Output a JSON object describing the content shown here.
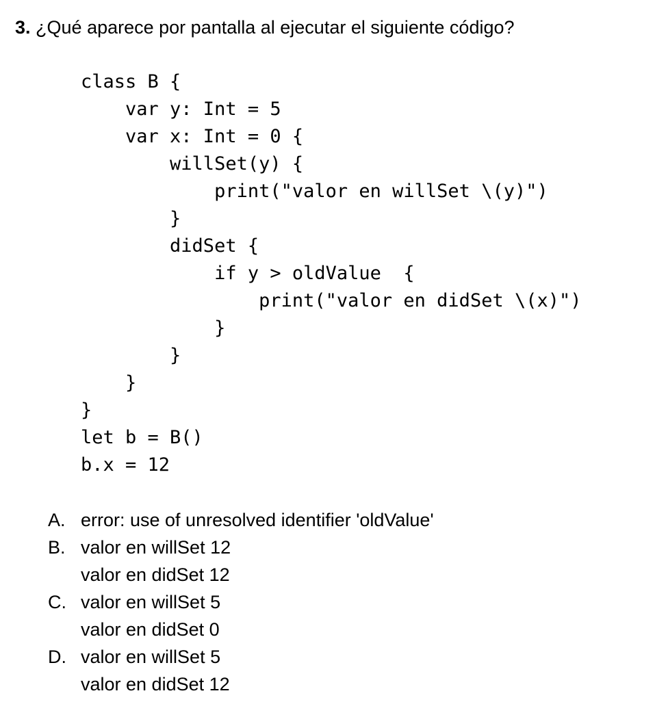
{
  "question": {
    "number": "3.",
    "text": "¿Qué aparece por pantalla al ejecutar el siguiente código?"
  },
  "code": [
    "class B {",
    "    var y: Int = 5",
    "    var x: Int = 0 {",
    "        willSet(y) {",
    "            print(\"valor en willSet \\(y)\")",
    "        }",
    "        didSet {",
    "            if y > oldValue  {",
    "                print(\"valor en didSet \\(x)\")",
    "            }",
    "        }",
    "    }",
    "}",
    "let b = B()",
    "b.x = 12"
  ],
  "options": [
    {
      "letter": "A.",
      "lines": [
        "error: use of unresolved identifier 'oldValue'"
      ]
    },
    {
      "letter": "B.",
      "lines": [
        "valor en willSet 12",
        "valor en didSet 12"
      ]
    },
    {
      "letter": "C.",
      "lines": [
        "valor en willSet 5",
        "valor en didSet 0"
      ]
    },
    {
      "letter": "D.",
      "lines": [
        "valor en willSet 5",
        "valor en didSet 12"
      ]
    }
  ]
}
